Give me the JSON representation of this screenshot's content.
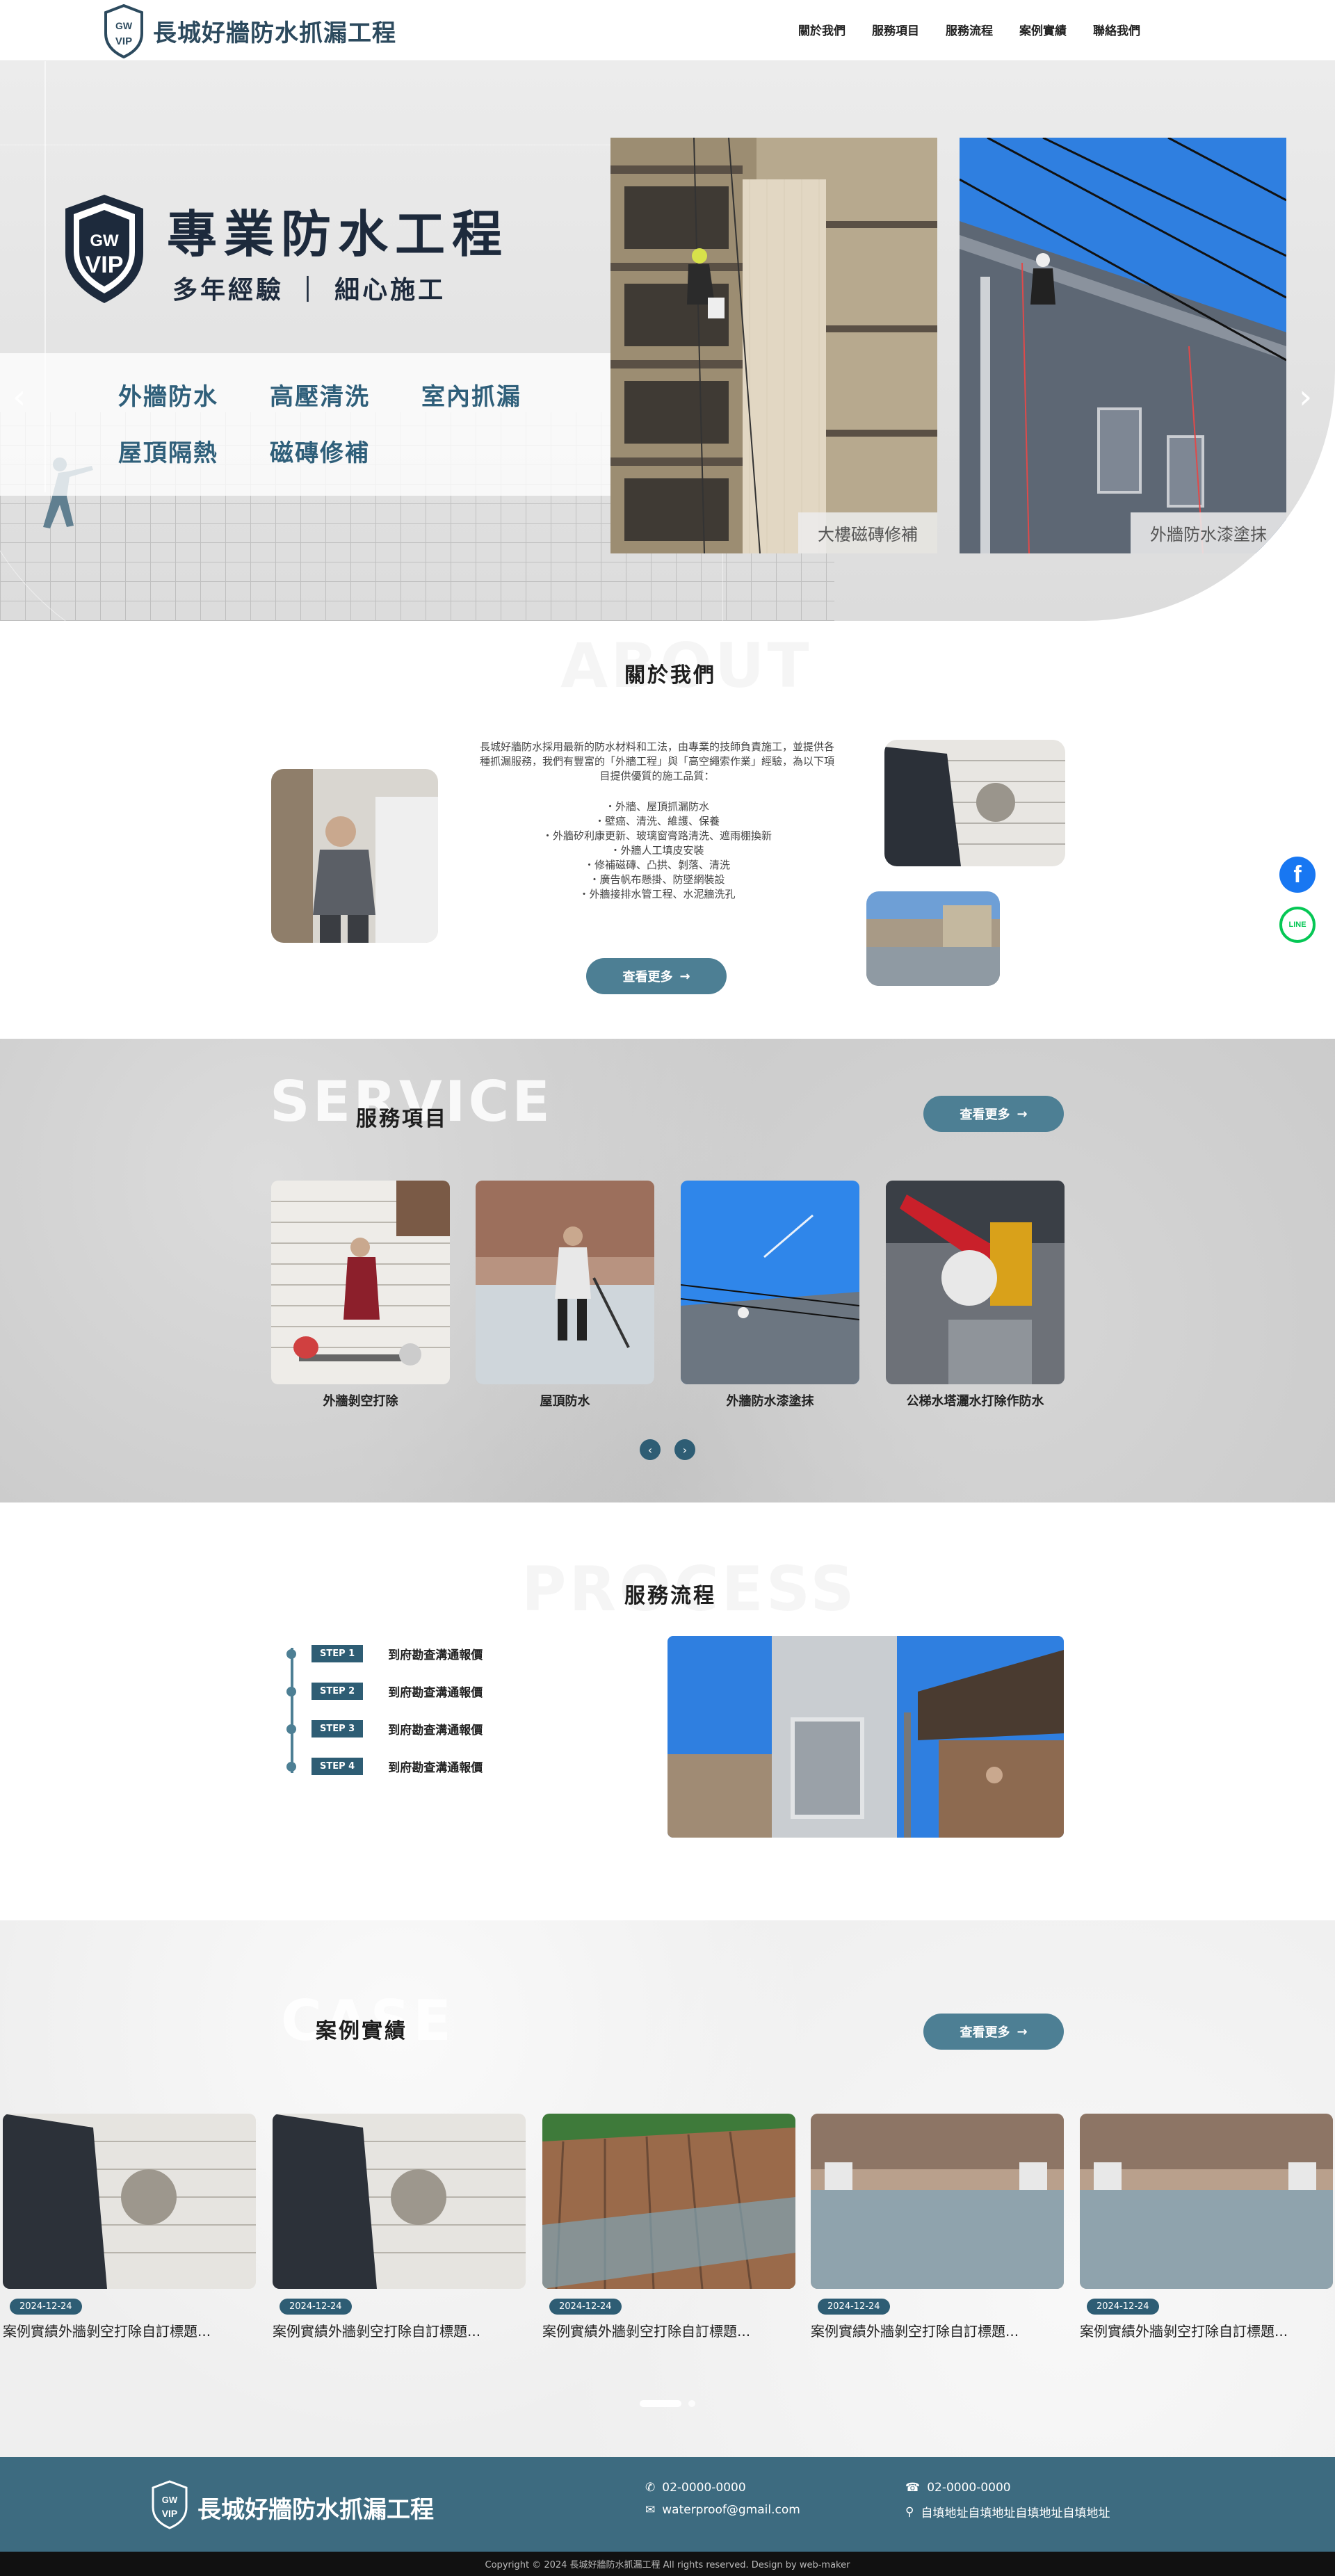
{
  "brand": {
    "name": "長城好牆防水抓漏工程",
    "badge_top": "GW",
    "badge_bottom": "VIP"
  },
  "nav": [
    "關於我們",
    "服務項目",
    "服務流程",
    "案例實績",
    "聯絡我們"
  ],
  "hero": {
    "title": "專業防水工程",
    "subtitle": "多年經驗 ｜ 細心施工",
    "tags": [
      "外牆防水",
      "高壓清洗",
      "室內抓漏",
      "屋頂隔熱",
      "磁磚修補"
    ],
    "photos": [
      "大樓磁磚修補",
      "外牆防水漆塗抹"
    ]
  },
  "about": {
    "ghost": "ABOUT",
    "title": "關於我們",
    "text": "長城好牆防水採用最新的防水材料和工法，由專業的技師負責施工，並提供各種抓漏服務，我們有豐富的「外牆工程」與「高空繩索作業」經驗，為以下項目提供優質的施工品質：",
    "items": [
      "・外牆、屋頂抓漏防水",
      "・壁癌、清洗、維護、保養",
      "・外牆矽利康更新、玻璃窗膏路清洗、遮雨棚換新",
      "・外牆人工填皮安裝",
      "・修補磁磚、凸拱、剝落、清洗",
      "・廣告帆布懸掛、防墜網裝設",
      "・外牆接排水管工程、水泥牆洗孔"
    ],
    "button": "查看更多"
  },
  "service": {
    "ghost": "SERVICE",
    "title": "服務項目",
    "button": "查看更多",
    "cards": [
      "外牆剝空打除",
      "屋頂防水",
      "外牆防水漆塗抹",
      "公梯水塔灑水打除作防水"
    ]
  },
  "process": {
    "ghost": "PROCESS",
    "title": "服務流程",
    "steps": [
      {
        "badge": "STEP 1",
        "text": "到府勘查溝通報價"
      },
      {
        "badge": "STEP 2",
        "text": "到府勘查溝通報價"
      },
      {
        "badge": "STEP 3",
        "text": "到府勘查溝通報價"
      },
      {
        "badge": "STEP 4",
        "text": "到府勘查溝通報價"
      }
    ]
  },
  "cases": {
    "ghost": "CASE",
    "title": "案例實績",
    "button": "查看更多",
    "items": [
      {
        "date": "2024-12-24",
        "title": "案例實績外牆剝空打除自訂標題..."
      },
      {
        "date": "2024-12-24",
        "title": "案例實績外牆剝空打除自訂標題..."
      },
      {
        "date": "2024-12-24",
        "title": "案例實績外牆剝空打除自訂標題..."
      },
      {
        "date": "2024-12-24",
        "title": "案例實績外牆剝空打除自訂標題..."
      },
      {
        "date": "2024-12-24",
        "title": "案例實績外牆剝空打除自訂標題..."
      }
    ]
  },
  "footer": {
    "phone1": "02-0000-0000",
    "email": "waterproof@gmail.com",
    "phone2": "02-0000-0000",
    "address": "自填地址自填地址自填地址自填地址",
    "copyright": "Copyright © 2024 長城好牆防水抓漏工程 All rights reserved. Design by web-maker"
  },
  "social": {
    "facebook": "f",
    "line": "LINE"
  },
  "colors": {
    "accent": "#4d7f94",
    "dark_accent": "#2e5d74",
    "brand_text": "#2c4a5e"
  }
}
